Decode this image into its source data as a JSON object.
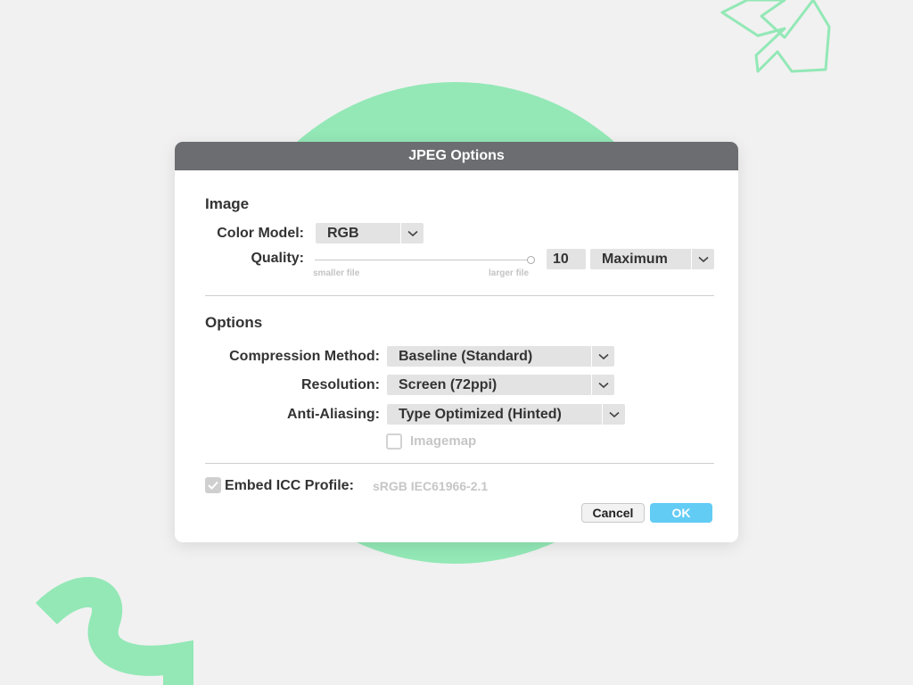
{
  "dialog": {
    "title": "JPEG Options",
    "image_section": {
      "title": "Image",
      "color_model": {
        "label": "Color Model:",
        "value": "RGB"
      },
      "quality": {
        "label": "Quality:",
        "value": "10",
        "level": 1.0,
        "preset": "Maximum",
        "hint_left": "smaller file",
        "hint_right": "larger file"
      }
    },
    "options_section": {
      "title": "Options",
      "compression": {
        "label": "Compression Method:",
        "value": "Baseline (Standard)"
      },
      "resolution": {
        "label": "Resolution:",
        "value": "Screen (72ppi)"
      },
      "anti_aliasing": {
        "label": "Anti-Aliasing:",
        "value": "Type Optimized (Hinted)"
      },
      "imagemap": {
        "label": "Imagemap",
        "checked": false
      }
    },
    "embed_icc": {
      "label": "Embed ICC Profile:",
      "profile": "sRGB IEC61966-2.1",
      "checked": true
    },
    "buttons": {
      "cancel": "Cancel",
      "ok": "OK"
    }
  },
  "colors": {
    "background": "#f1f1f1",
    "accent_green": "#93e8b6",
    "titlebar": "#6b6d70",
    "ok_button": "#62ccf5"
  },
  "icons": {
    "dropdown": "chevron-down-icon",
    "check": "checkmark-icon"
  }
}
